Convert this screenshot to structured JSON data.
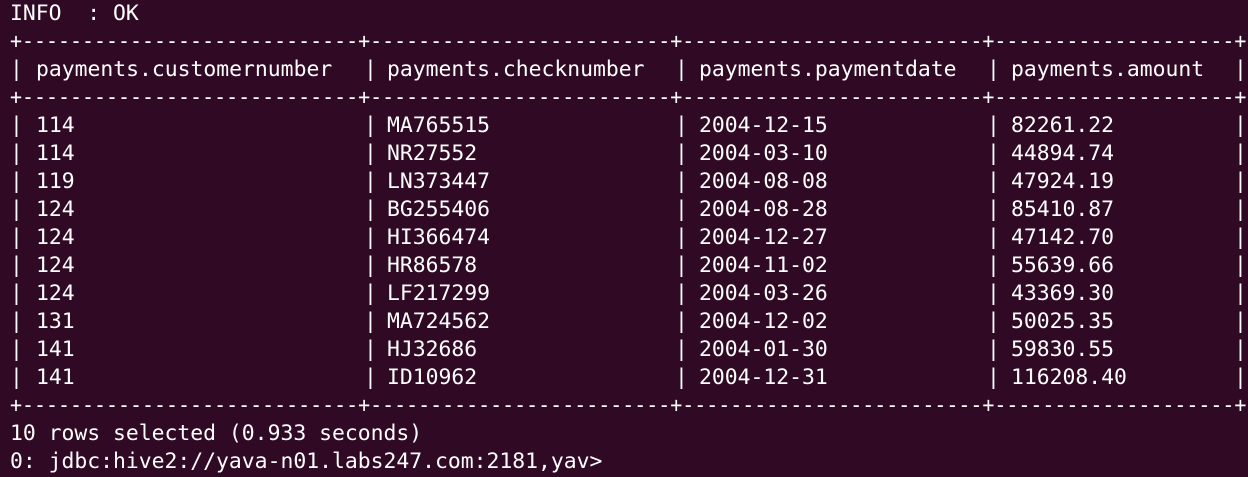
{
  "status_line": "INFO  : OK",
  "table": {
    "border_line": "+----------------------------+-------------------------+-------------------------+--------------------+",
    "columns": [
      "payments.customernumber",
      "payments.checknumber",
      "payments.paymentdate",
      "payments.amount"
    ],
    "rows": [
      [
        "114",
        "MA765515",
        "2004-12-15",
        "82261.22"
      ],
      [
        "114",
        "NR27552",
        "2004-03-10",
        "44894.74"
      ],
      [
        "119",
        "LN373447",
        "2004-08-08",
        "47924.19"
      ],
      [
        "124",
        "BG255406",
        "2004-08-28",
        "85410.87"
      ],
      [
        "124",
        "HI366474",
        "2004-12-27",
        "47142.70"
      ],
      [
        "124",
        "HR86578",
        "2004-11-02",
        "55639.66"
      ],
      [
        "124",
        "LF217299",
        "2004-03-26",
        "43369.30"
      ],
      [
        "131",
        "MA724562",
        "2004-12-02",
        "50025.35"
      ],
      [
        "141",
        "HJ32686",
        "2004-01-30",
        "59830.55"
      ],
      [
        "141",
        "ID10962",
        "2004-12-31",
        "116208.40"
      ]
    ]
  },
  "summary_line": "10 rows selected (0.933 seconds)",
  "prompt_line": "0: jdbc:hive2://yava-n01.labs247.com:2181,yav>"
}
